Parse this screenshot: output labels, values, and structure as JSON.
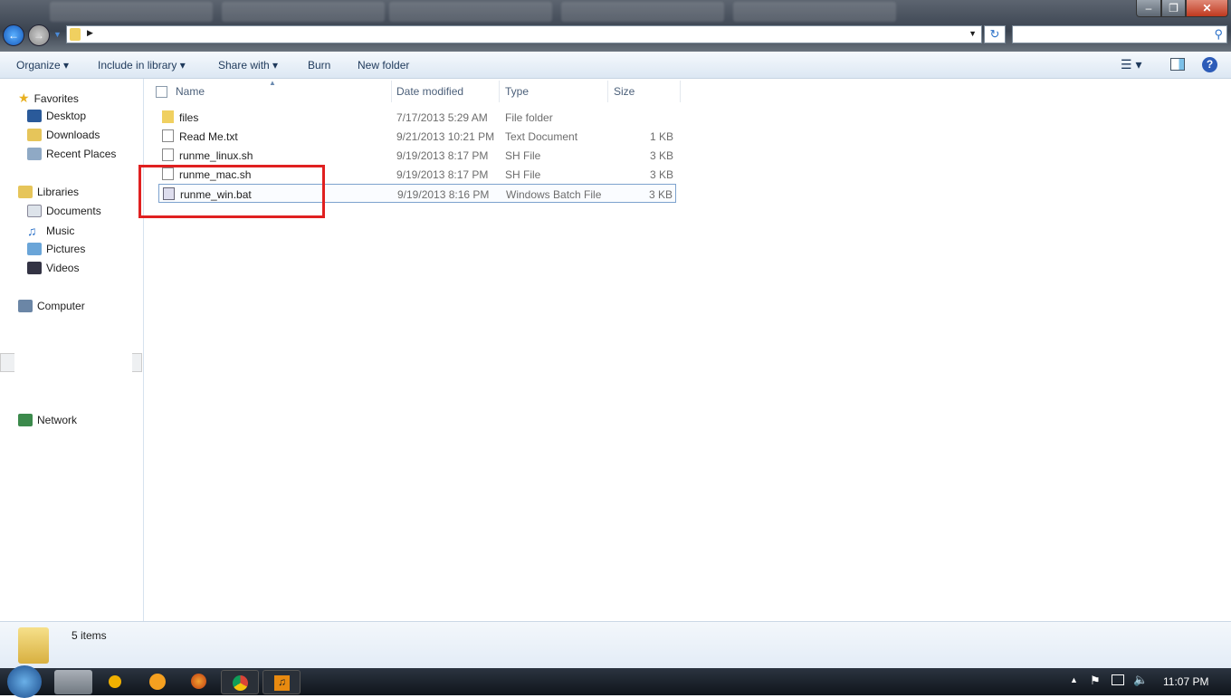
{
  "toolbar": {
    "organize": "Organize",
    "include_in_library": "Include in library",
    "share_with": "Share with",
    "burn": "Burn",
    "new_folder": "New folder"
  },
  "nav": {
    "favorites": "Favorites",
    "desktop": "Desktop",
    "downloads": "Downloads",
    "recent_places": "Recent Places",
    "libraries": "Libraries",
    "documents": "Documents",
    "music": "Music",
    "pictures": "Pictures",
    "videos": "Videos",
    "computer": "Computer",
    "network": "Network"
  },
  "columns": {
    "name": "Name",
    "date": "Date modified",
    "type": "Type",
    "size": "Size"
  },
  "files": [
    {
      "name": "files",
      "date": "7/17/2013 5:29 AM",
      "type": "File folder",
      "size": "",
      "icon": "folder-icon"
    },
    {
      "name": "Read Me.txt",
      "date": "9/21/2013 10:21 PM",
      "type": "Text Document",
      "size": "1 KB",
      "icon": "text-file-icon"
    },
    {
      "name": "runme_linux.sh",
      "date": "9/19/2013 8:17 PM",
      "type": "SH File",
      "size": "3 KB",
      "icon": "file-icon"
    },
    {
      "name": "runme_mac.sh",
      "date": "9/19/2013 8:17 PM",
      "type": "SH File",
      "size": "3 KB",
      "icon": "file-icon"
    },
    {
      "name": "runme_win.bat",
      "date": "9/19/2013 8:16 PM",
      "type": "Windows Batch File",
      "size": "3 KB",
      "icon": "batch-file-icon",
      "selected": true
    }
  ],
  "status": {
    "count": "5 items"
  },
  "taskbar": {
    "clock": "11:07 PM"
  },
  "colors": {
    "highlight": "#e02020",
    "accent": "#1e395b"
  }
}
